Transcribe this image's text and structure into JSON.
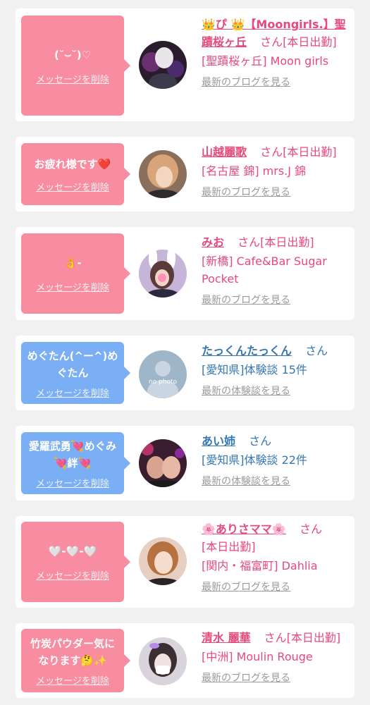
{
  "colors": {
    "pink": "#f88ca0",
    "blue": "#7aaef5",
    "name_pink": "#e8487a",
    "name_blue": "#3477b3"
  },
  "delete_label": "メッセージを削除",
  "cards": [
    {
      "message": "(˘⌣˘)♡",
      "name": "👑ぴ 👑【Moongirls.】聖蹟桜ヶ丘",
      "suffix": "さん",
      "status": "[本日出勤]",
      "shop": "[聖蹟桜ヶ丘] Moon girls",
      "link": "最新のブログを見る"
    },
    {
      "message": "お疲れ様です❤️",
      "name": "山越麗歌",
      "suffix": "さん",
      "status": "[本日出勤]",
      "shop": "[名古屋 錦] mrs.J 錦",
      "link": "最新のブログを見る"
    },
    {
      "message": "👌-",
      "name": "みお",
      "suffix": "さん",
      "status": "[本日出勤]",
      "shop": "[新橋] Cafe&Bar Sugar Pocket",
      "link": "最新のブログを見る"
    },
    {
      "message": "めぐたん(^ー^)めぐたん",
      "name": "たっくんたっくん",
      "suffix": "さん",
      "status": "",
      "shop": "[愛知県]体験談 15件",
      "link": "最新の体験談を見る",
      "no_photo": "no photo"
    },
    {
      "message": "愛羅武勇💘めぐみ💘絆💘",
      "name": "あい姉",
      "suffix": "さん",
      "status": "",
      "shop": "[愛知県]体験談 22件",
      "link": "最新の体験談を見る"
    },
    {
      "message": "🤍-🤍-🤍",
      "name": "🌸ありさママ🌸",
      "suffix": "さん",
      "status": "[本日出勤]",
      "shop": "[関内・福富町] Dahlia",
      "link": "最新のブログを見る"
    },
    {
      "message": "竹炭パウダー気になります🤔✨",
      "name": "清水 麗華",
      "suffix": "さん",
      "status": "[本日出勤]",
      "shop": "[中洲] Moulin Rouge",
      "link": "最新のブログを見る"
    }
  ]
}
